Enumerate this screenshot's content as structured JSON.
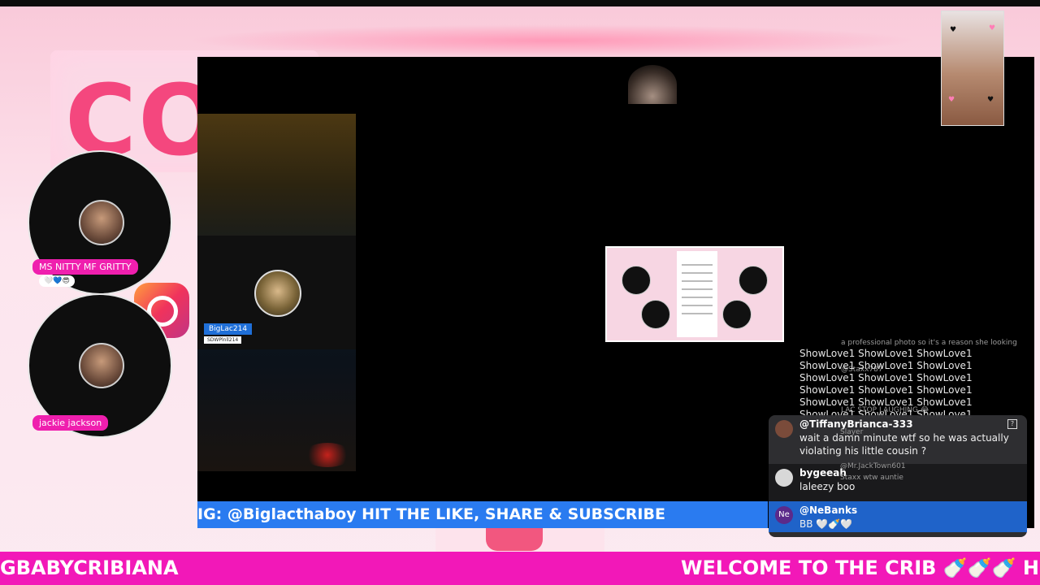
{
  "backdrop": {
    "logo_text": "CO"
  },
  "guests": [
    {
      "name": "MS NITTY MF GRITTY",
      "mini_tag": "🤍💙😎"
    },
    {
      "name": "jackie jackson"
    }
  ],
  "main_stream": {
    "left_cam_tag": "BigLac214",
    "left_cam_subtag": "SDWPlnll214"
  },
  "ig_bar": {
    "text": "IG: @Biglacthaboy HIT THE LIKE, SHARE & SUBSCRIBE"
  },
  "chat": {
    "showlove_text": "ShowLove1 ShowLove1 ShowLove1 ShowLove1 ShowLove1 ShowLove1 ShowLove1 ShowLove1 ShowLove1 ShowLove1 ShowLove1 ShowLove1 ShowLove1 ShowLove1 ShowLove1 ShowLove1 ShowLove1 ShowLove1",
    "ghost_lines": [
      "a professional photo so it's a reason she looking",
      "@Staxx787",
      "LAC STOP LAUGHING 😂",
      "Slayer",
      "@Mr.JackTown601",
      "Staxx wtw auntie"
    ],
    "messages": [
      {
        "user": "@TiffanyBrianca-333",
        "text": "wait a damn minute wtf so he was actually violating his little cousin ?",
        "avatar_color": "#7a4b3a"
      },
      {
        "user": "bygeeah",
        "text": "laleezy boo",
        "avatar_color": "#d8d8d8"
      },
      {
        "user": "@NeBanks",
        "text": "BB 🤍🍼🤍",
        "avatar_color": "#5b2a8a",
        "avatar_initials": "Ne"
      }
    ]
  },
  "marquee": {
    "left_text": "GBABYCRIBIANA",
    "right_text": "WELCOME TO THE CRIB 🍼🍼🍼 HIT"
  }
}
